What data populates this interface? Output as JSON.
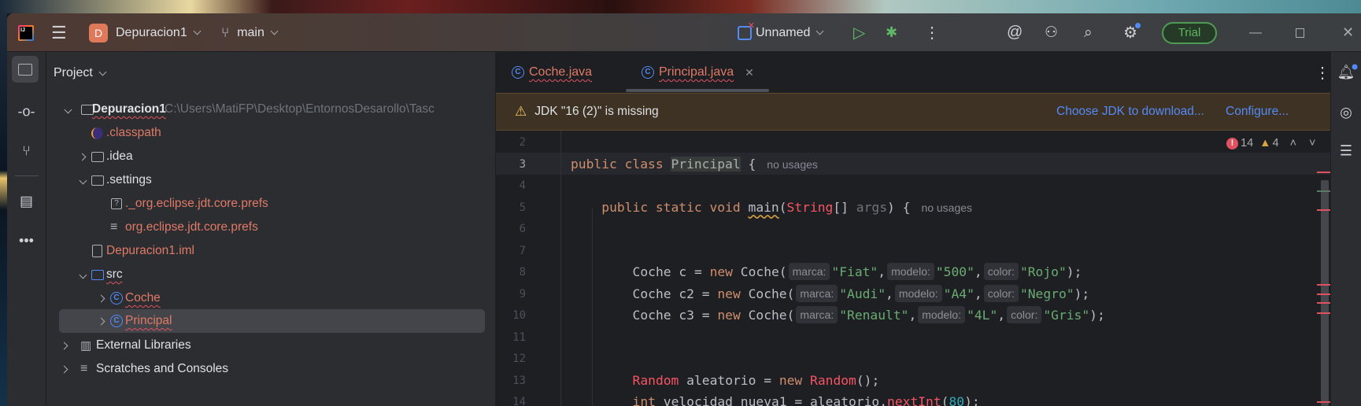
{
  "titlebar": {
    "project_badge": "D",
    "project_name": "Depuracion1",
    "branch": "main",
    "run_config": "Unnamed",
    "trial": "Trial"
  },
  "toolstrip": {
    "items": [
      "project-icon",
      "commit-icon",
      "pull-requests-icon",
      "structure-icon",
      "more-icon"
    ]
  },
  "project": {
    "header": "Project",
    "root": {
      "label": "Depuracion1",
      "path": "C:\\Users\\MatiFP\\Desktop\\EntornosDesarollo\\Tasc"
    },
    "items": [
      {
        "label": ".classpath"
      },
      {
        "label": ".idea"
      },
      {
        "label": ".settings"
      },
      {
        "label": "._org.eclipse.jdt.core.prefs"
      },
      {
        "label": "org.eclipse.jdt.core.prefs"
      },
      {
        "label": "Depuracion1.iml"
      },
      {
        "label": "src"
      },
      {
        "label": "Coche"
      },
      {
        "label": "Principal"
      },
      {
        "label": "External Libraries"
      },
      {
        "label": "Scratches and Consoles"
      }
    ]
  },
  "tabs": [
    {
      "label": "Coche.java",
      "active": false
    },
    {
      "label": "Principal.java",
      "active": true
    }
  ],
  "banner": {
    "message": "JDK \"16 (2)\" is missing",
    "action1": "Choose JDK to download...",
    "action2": "Configure..."
  },
  "inspections": {
    "errors": "14",
    "warnings": "4"
  },
  "colors": {
    "keyword": "#cf8e6d",
    "string": "#6aab73",
    "error": "#f75464",
    "number": "#2aacb8",
    "banner_bg": "#3d3223",
    "link": "#548af7",
    "trial": "#5fb865"
  },
  "editor": {
    "lines": [
      {
        "n": "2",
        "tokens": []
      },
      {
        "n": "3",
        "tokens": [
          {
            "t": "public class ",
            "c": "k"
          },
          {
            "t": "Principal",
            "c": "hl"
          },
          {
            "t": " {",
            "c": ""
          },
          {
            "t": "no usages",
            "c": "usage"
          }
        ]
      },
      {
        "n": "4",
        "tokens": []
      },
      {
        "n": "5",
        "indent": 4,
        "tokens": [
          {
            "t": "public static void ",
            "c": "k"
          },
          {
            "t": "main",
            "c": "warn"
          },
          {
            "t": "(",
            "c": ""
          },
          {
            "t": "String",
            "c": "e"
          },
          {
            "t": "[] ",
            "c": ""
          },
          {
            "t": "args",
            "c": "g"
          },
          {
            "t": ") {",
            "c": ""
          },
          {
            "t": "no usages",
            "c": "usage"
          }
        ]
      },
      {
        "n": "6",
        "tokens": []
      },
      {
        "n": "7",
        "tokens": []
      },
      {
        "n": "8",
        "indent": 8,
        "tokens": [
          {
            "t": "Coche c = ",
            "c": ""
          },
          {
            "t": "new ",
            "c": "k"
          },
          {
            "t": "Coche(",
            "c": ""
          },
          {
            "t": "marca:",
            "c": "hint"
          },
          {
            "t": "\"Fiat\"",
            "c": "s"
          },
          {
            "t": ",",
            "c": ""
          },
          {
            "t": "modelo:",
            "c": "hint"
          },
          {
            "t": "\"500\"",
            "c": "s"
          },
          {
            "t": ",",
            "c": ""
          },
          {
            "t": "color:",
            "c": "hint"
          },
          {
            "t": "\"Rojo\"",
            "c": "s"
          },
          {
            "t": ");",
            "c": ""
          }
        ]
      },
      {
        "n": "9",
        "indent": 8,
        "tokens": [
          {
            "t": "Coche c2 = ",
            "c": ""
          },
          {
            "t": "new ",
            "c": "k"
          },
          {
            "t": "Coche(",
            "c": ""
          },
          {
            "t": "marca:",
            "c": "hint"
          },
          {
            "t": "\"Audi\"",
            "c": "s"
          },
          {
            "t": ",",
            "c": ""
          },
          {
            "t": "modelo:",
            "c": "hint"
          },
          {
            "t": "\"A4\"",
            "c": "s"
          },
          {
            "t": ",",
            "c": ""
          },
          {
            "t": "color:",
            "c": "hint"
          },
          {
            "t": "\"Negro\"",
            "c": "s"
          },
          {
            "t": ");",
            "c": ""
          }
        ]
      },
      {
        "n": "10",
        "indent": 8,
        "tokens": [
          {
            "t": "Coche c3 = ",
            "c": ""
          },
          {
            "t": "new ",
            "c": "k"
          },
          {
            "t": "Coche(",
            "c": ""
          },
          {
            "t": "marca:",
            "c": "hint"
          },
          {
            "t": "\"Renault\"",
            "c": "s"
          },
          {
            "t": ",",
            "c": ""
          },
          {
            "t": "modelo:",
            "c": "hint"
          },
          {
            "t": "\"4L\"",
            "c": "s"
          },
          {
            "t": ",",
            "c": ""
          },
          {
            "t": "color:",
            "c": "hint"
          },
          {
            "t": "\"Gris\"",
            "c": "s"
          },
          {
            "t": ");",
            "c": ""
          }
        ]
      },
      {
        "n": "11",
        "tokens": []
      },
      {
        "n": "12",
        "tokens": []
      },
      {
        "n": "13",
        "indent": 8,
        "tokens": [
          {
            "t": "Random",
            "c": "e"
          },
          {
            "t": " aleatorio = ",
            "c": ""
          },
          {
            "t": "new ",
            "c": "k"
          },
          {
            "t": "Random",
            "c": "e"
          },
          {
            "t": "();",
            "c": ""
          }
        ]
      },
      {
        "n": "14",
        "indent": 8,
        "tokens": [
          {
            "t": "int ",
            "c": "k"
          },
          {
            "t": "velocidad_nueva1 = aleatorio.",
            "c": ""
          },
          {
            "t": "nextInt",
            "c": "e"
          },
          {
            "t": "(",
            "c": ""
          },
          {
            "t": "80",
            "c": "n"
          },
          {
            "t": ");",
            "c": ""
          }
        ]
      }
    ]
  }
}
